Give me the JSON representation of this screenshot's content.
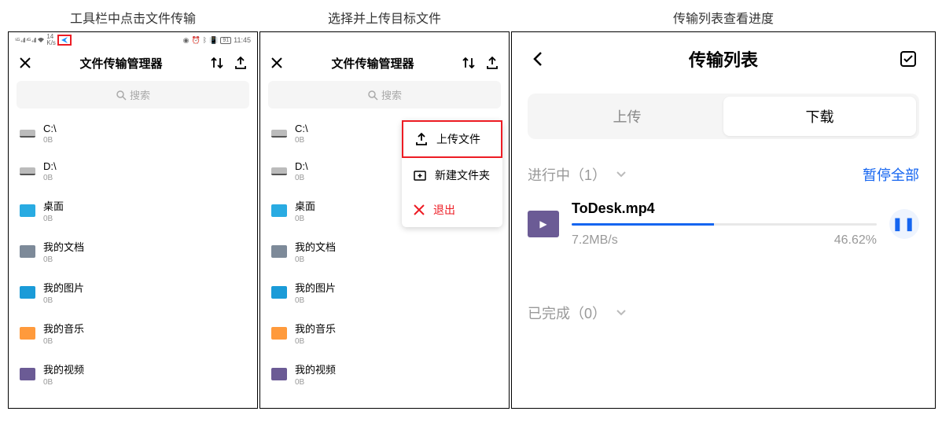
{
  "captions": {
    "c1": "工具栏中点击文件传输",
    "c2": "选择并上传目标文件",
    "c3": "传输列表查看进度"
  },
  "status": {
    "signals": "5G 4G",
    "net": "14",
    "net_unit": "K/s",
    "battery": "91",
    "time": "11:45"
  },
  "fm": {
    "title": "文件传输管理器",
    "search_placeholder": "搜索",
    "items": [
      {
        "name": "C:\\",
        "size": "0B",
        "type": "drive"
      },
      {
        "name": "D:\\",
        "size": "0B",
        "type": "drive"
      },
      {
        "name": "桌面",
        "size": "0B",
        "type": "folder-blue"
      },
      {
        "name": "我的文档",
        "size": "0B",
        "type": "folder-gray"
      },
      {
        "name": "我的图片",
        "size": "0B",
        "type": "folder-cyan"
      },
      {
        "name": "我的音乐",
        "size": "0B",
        "type": "folder-orange"
      },
      {
        "name": "我的视频",
        "size": "0B",
        "type": "folder-purple"
      }
    ]
  },
  "menu": {
    "upload": "上传文件",
    "newfolder": "新建文件夹",
    "exit": "退出"
  },
  "transfer": {
    "title": "传输列表",
    "tab_upload": "上传",
    "tab_download": "下载",
    "in_progress_prefix": "进行中（",
    "in_progress_count": "1",
    "in_progress_suffix": "）",
    "pause_all": "暂停全部",
    "file_name": "ToDesk.mp4",
    "speed": "7.2MB/s",
    "percent": "46.62%",
    "percent_value": 46.62,
    "completed_prefix": "已完成（",
    "completed_count": "0",
    "completed_suffix": "）"
  }
}
